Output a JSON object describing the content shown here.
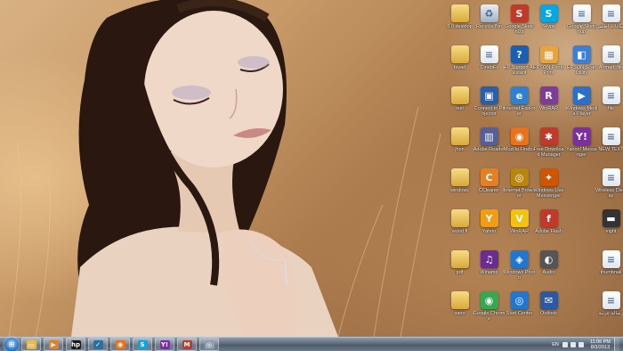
{
  "desktop": {
    "icons": [
      {
        "label": "8.0 desktop",
        "icon": "folder-icon",
        "color": "#e0b24a",
        "glyph": ""
      },
      {
        "label": "Recycle Bin",
        "icon": "recycle-bin-icon",
        "color": "#9fb0c4",
        "glyph": "♻"
      },
      {
        "label": "Google SketchUp",
        "icon": "sketchup-icon",
        "color": "#c0392b",
        "glyph": "S"
      },
      {
        "label": "Skype",
        "icon": "skype-icon",
        "color": "#00a8e8",
        "glyph": "S"
      },
      {
        "label": "Google Sketchup",
        "icon": "doc-icon",
        "color": "#eef2f6",
        "glyph": "≡"
      },
      {
        "label": "سكانات اطلس",
        "icon": "file-icon",
        "color": "#eef2f6",
        "glyph": "≡"
      },
      {
        "label": "fayad",
        "icon": "folder-icon",
        "color": "#e0b24a",
        "glyph": ""
      },
      {
        "label": "CinebEr",
        "icon": "file-icon",
        "color": "#eef2f6",
        "glyph": "≡"
      },
      {
        "label": "HP Support Assistant",
        "icon": "hp-support-icon",
        "color": "#1a5fb4",
        "glyph": "?"
      },
      {
        "label": "EPSON Photo Print",
        "icon": "tiles-icon",
        "color": "#e8a33d",
        "glyph": "▦"
      },
      {
        "label": "EPSON Scan Utility",
        "icon": "scan-icon",
        "color": "#3d7fd6",
        "glyph": "◧"
      },
      {
        "label": "Ahmad_file",
        "icon": "file-icon",
        "color": "#eef2f6",
        "glyph": "≡"
      },
      {
        "label": "test",
        "icon": "folder-icon",
        "color": "#e0b24a",
        "glyph": ""
      },
      {
        "label": "Connect to Projector",
        "icon": "computer-icon",
        "color": "#2b5ea8",
        "glyph": "▣"
      },
      {
        "label": "Internet Explorer",
        "icon": "ie-icon",
        "color": "#2f80d1",
        "glyph": "e"
      },
      {
        "label": "WinRAR",
        "icon": "winrar-icon",
        "color": "#7d3c98",
        "glyph": "R"
      },
      {
        "label": "Windows Media Player",
        "icon": "media-player-icon",
        "color": "#2a6fca",
        "glyph": "▶"
      },
      {
        "label": "file",
        "icon": "doc-icon",
        "color": "#eef2f6",
        "glyph": "≡"
      },
      {
        "label": "jhon",
        "icon": "folder-icon",
        "color": "#e0b24a",
        "glyph": ""
      },
      {
        "label": "Adobe Reader",
        "icon": "books-icon",
        "color": "#555f9a",
        "glyph": "▥"
      },
      {
        "label": "Mozilla Firefox",
        "icon": "firefox-icon",
        "color": "#e8731c",
        "glyph": "◉"
      },
      {
        "label": "Free Download Manager",
        "icon": "fdm-icon",
        "color": "#c0392b",
        "glyph": "✱"
      },
      {
        "label": "Yahoo! Messenger",
        "icon": "yahoo-icon",
        "color": "#7b2fa0",
        "glyph": "Y!"
      },
      {
        "label": "NEW TEXT",
        "icon": "file-icon",
        "color": "#eef2f6",
        "glyph": "≡"
      },
      {
        "label": "windows",
        "icon": "folder-icon",
        "color": "#e0b24a",
        "glyph": ""
      },
      {
        "label": "CCleaner",
        "icon": "ccleaner-icon",
        "color": "#e67e22",
        "glyph": "C"
      },
      {
        "label": "Internet Browser",
        "icon": "globe-icon",
        "color": "#b8860b",
        "glyph": "◎"
      },
      {
        "label": "Windows Live Messenger",
        "icon": "messenger-icon",
        "color": "#d35400",
        "glyph": "✦"
      },
      {
        "label": "Wireless Display",
        "icon": "doc-icon",
        "color": "#eef2f6",
        "glyph": "≡"
      },
      {
        "label": "wood fl",
        "icon": "folder-icon",
        "color": "#e0b24a",
        "glyph": ""
      },
      {
        "label": "Yahoo",
        "icon": "yahoo-icon",
        "color": "#f39c12",
        "glyph": "Y"
      },
      {
        "label": "WinRAR",
        "icon": "v-icon",
        "color": "#f4c20d",
        "glyph": "V"
      },
      {
        "label": "Adobe Flash",
        "icon": "flash-icon",
        "color": "#c0392b",
        "glyph": "f"
      },
      {
        "label": "eight",
        "icon": "film-icon",
        "color": "#333333",
        "glyph": "▬"
      },
      {
        "label": "pdf",
        "icon": "folder-icon",
        "color": "#e0b24a",
        "glyph": ""
      },
      {
        "label": "Winamp",
        "icon": "music-icon",
        "color": "#6a2c91",
        "glyph": "♫"
      },
      {
        "label": "Windows Photo",
        "icon": "photo-icon",
        "color": "#1f77d0",
        "glyph": "◈"
      },
      {
        "label": "Audio",
        "icon": "speaker-icon",
        "color": "#555555",
        "glyph": "◐"
      },
      {
        "label": "thumbnail",
        "icon": "doc-icon",
        "color": "#eef2f6",
        "glyph": "≡"
      },
      {
        "label": "vario",
        "icon": "folder-icon",
        "color": "#e0b24a",
        "glyph": ""
      },
      {
        "label": "Google Chrome",
        "icon": "chrome-icon",
        "color": "#34a853",
        "glyph": "◉"
      },
      {
        "label": "Start Center",
        "icon": "globe-icon",
        "color": "#1f77d0",
        "glyph": "◎"
      },
      {
        "label": "Outlook",
        "icon": "mail-icon",
        "color": "#2a5aa6",
        "glyph": "✉"
      },
      {
        "label": "رسالة عربية",
        "icon": "doc-icon",
        "color": "#eef2f6",
        "glyph": "≡"
      }
    ]
  },
  "taskbar": {
    "pinned": [
      {
        "name": "explorer-icon",
        "color": "#e9b949",
        "glyph": "▭"
      },
      {
        "name": "media-player-icon",
        "color": "#e67e22",
        "glyph": "▶"
      },
      {
        "name": "hp-icon",
        "color": "#1a1a1a",
        "glyph": "hp"
      },
      {
        "name": "checkmark-icon",
        "color": "#2471a3",
        "glyph": "✓"
      },
      {
        "name": "firefox-icon",
        "color": "#e8731c",
        "glyph": "◉"
      },
      {
        "name": "skype-icon",
        "color": "#00a8e8",
        "glyph": "S"
      },
      {
        "name": "yahoo-icon",
        "color": "#7b2fa0",
        "glyph": "Y!"
      },
      {
        "name": "mail-icon",
        "color": "#c0392b",
        "glyph": "M"
      },
      {
        "name": "globe-icon",
        "color": "#8e9eab",
        "glyph": "◎"
      }
    ],
    "tray": {
      "language": "EN",
      "time": "11:06 PM",
      "date": "8/3/2013"
    }
  }
}
